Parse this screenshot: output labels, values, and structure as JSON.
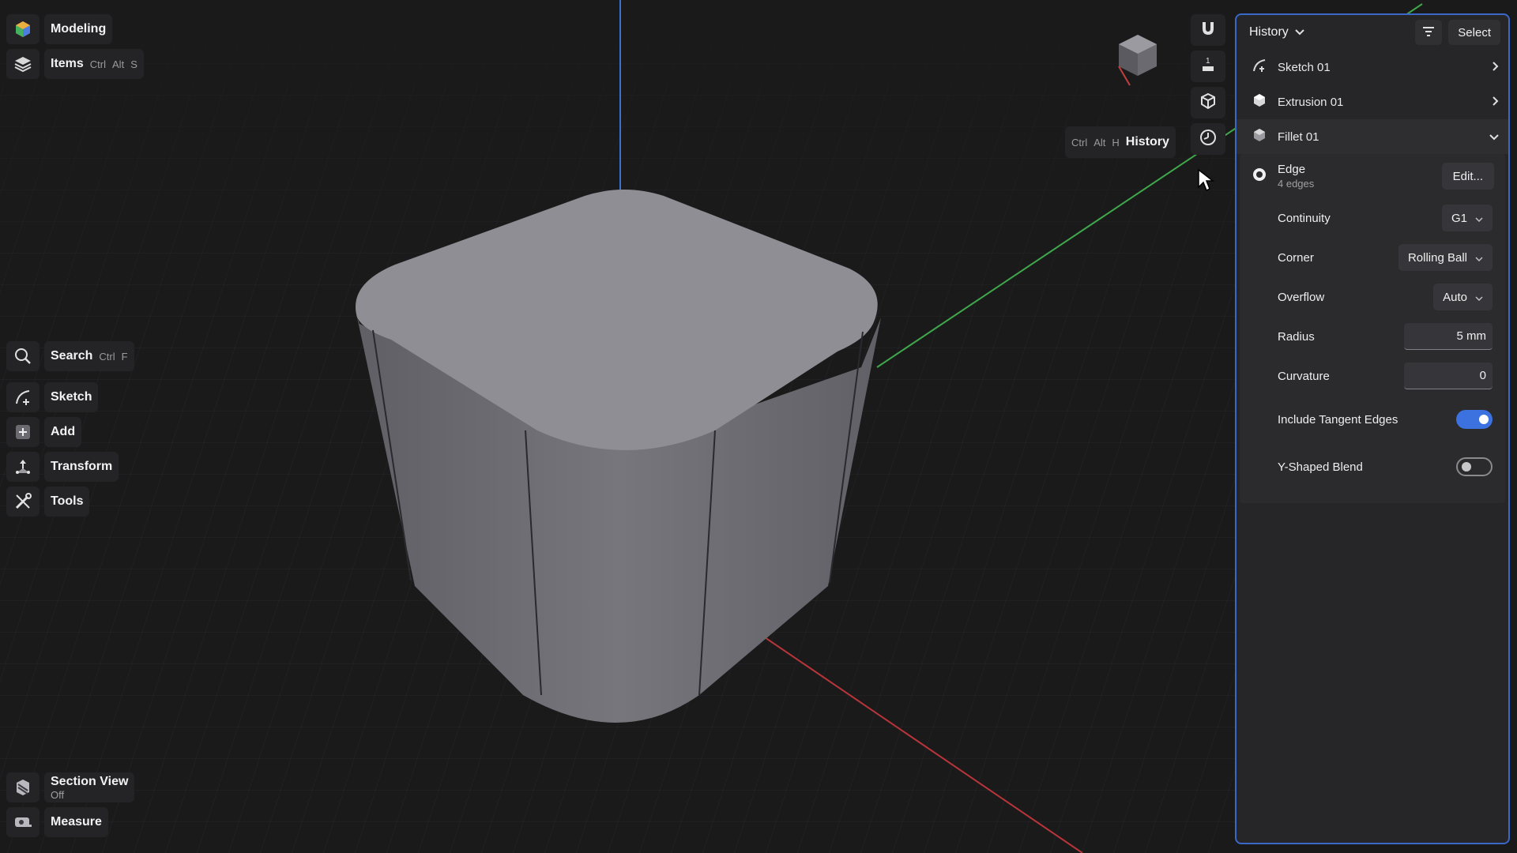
{
  "app": {
    "workspace_label": "Modeling",
    "items_label": "Items",
    "items_shortcut": [
      "Ctrl",
      "Alt",
      "S"
    ]
  },
  "left_tools": [
    {
      "label": "Search",
      "shortcut": [
        "Ctrl",
        "F"
      ],
      "icon": "search-icon"
    },
    {
      "label": "Sketch",
      "icon": "sketch-icon"
    },
    {
      "label": "Add",
      "icon": "add-icon"
    },
    {
      "label": "Transform",
      "icon": "transform-icon"
    },
    {
      "label": "Tools",
      "icon": "tools-icon"
    }
  ],
  "bottom_tools": {
    "section_view": {
      "label": "Section View",
      "state": "Off"
    },
    "measure": {
      "label": "Measure"
    }
  },
  "history_tooltip": {
    "keys": [
      "Ctrl",
      "Alt",
      "H"
    ],
    "label": "History"
  },
  "view_strip_icons": [
    "view-cube",
    "magnet-icon",
    "ruler-icon",
    "view-box-icon",
    "history-clock-icon"
  ],
  "panel": {
    "title": "History",
    "select_label": "Select",
    "history_items": [
      {
        "label": "Sketch 01",
        "icon": "sketch-icon",
        "state": "collapsed"
      },
      {
        "label": "Extrusion 01",
        "icon": "extrusion-icon",
        "state": "collapsed"
      },
      {
        "label": "Fillet 01",
        "icon": "fillet-icon",
        "state": "expanded"
      }
    ],
    "fillet": {
      "edge_title": "Edge",
      "edge_count": "4 edges",
      "edit_label": "Edit...",
      "continuity": {
        "label": "Continuity",
        "value": "G1"
      },
      "corner": {
        "label": "Corner",
        "value": "Rolling Ball"
      },
      "overflow": {
        "label": "Overflow",
        "value": "Auto"
      },
      "radius": {
        "label": "Radius",
        "value": "5 mm"
      },
      "curvature": {
        "label": "Curvature",
        "value": "0"
      },
      "include_tangent": {
        "label": "Include Tangent Edges",
        "on": true
      },
      "y_shaped": {
        "label": "Y-Shaped Blend",
        "on": false
      }
    }
  },
  "colors": {
    "background": "#1a1a1b",
    "panel_border": "#3a68c8",
    "accent_blue": "#3c72e0",
    "axis_x": "#b8353a",
    "axis_y": "#3fa84a",
    "axis_z": "#3b6fd0",
    "model_top": "#8e8e94",
    "model_side": "#6c6c72"
  }
}
